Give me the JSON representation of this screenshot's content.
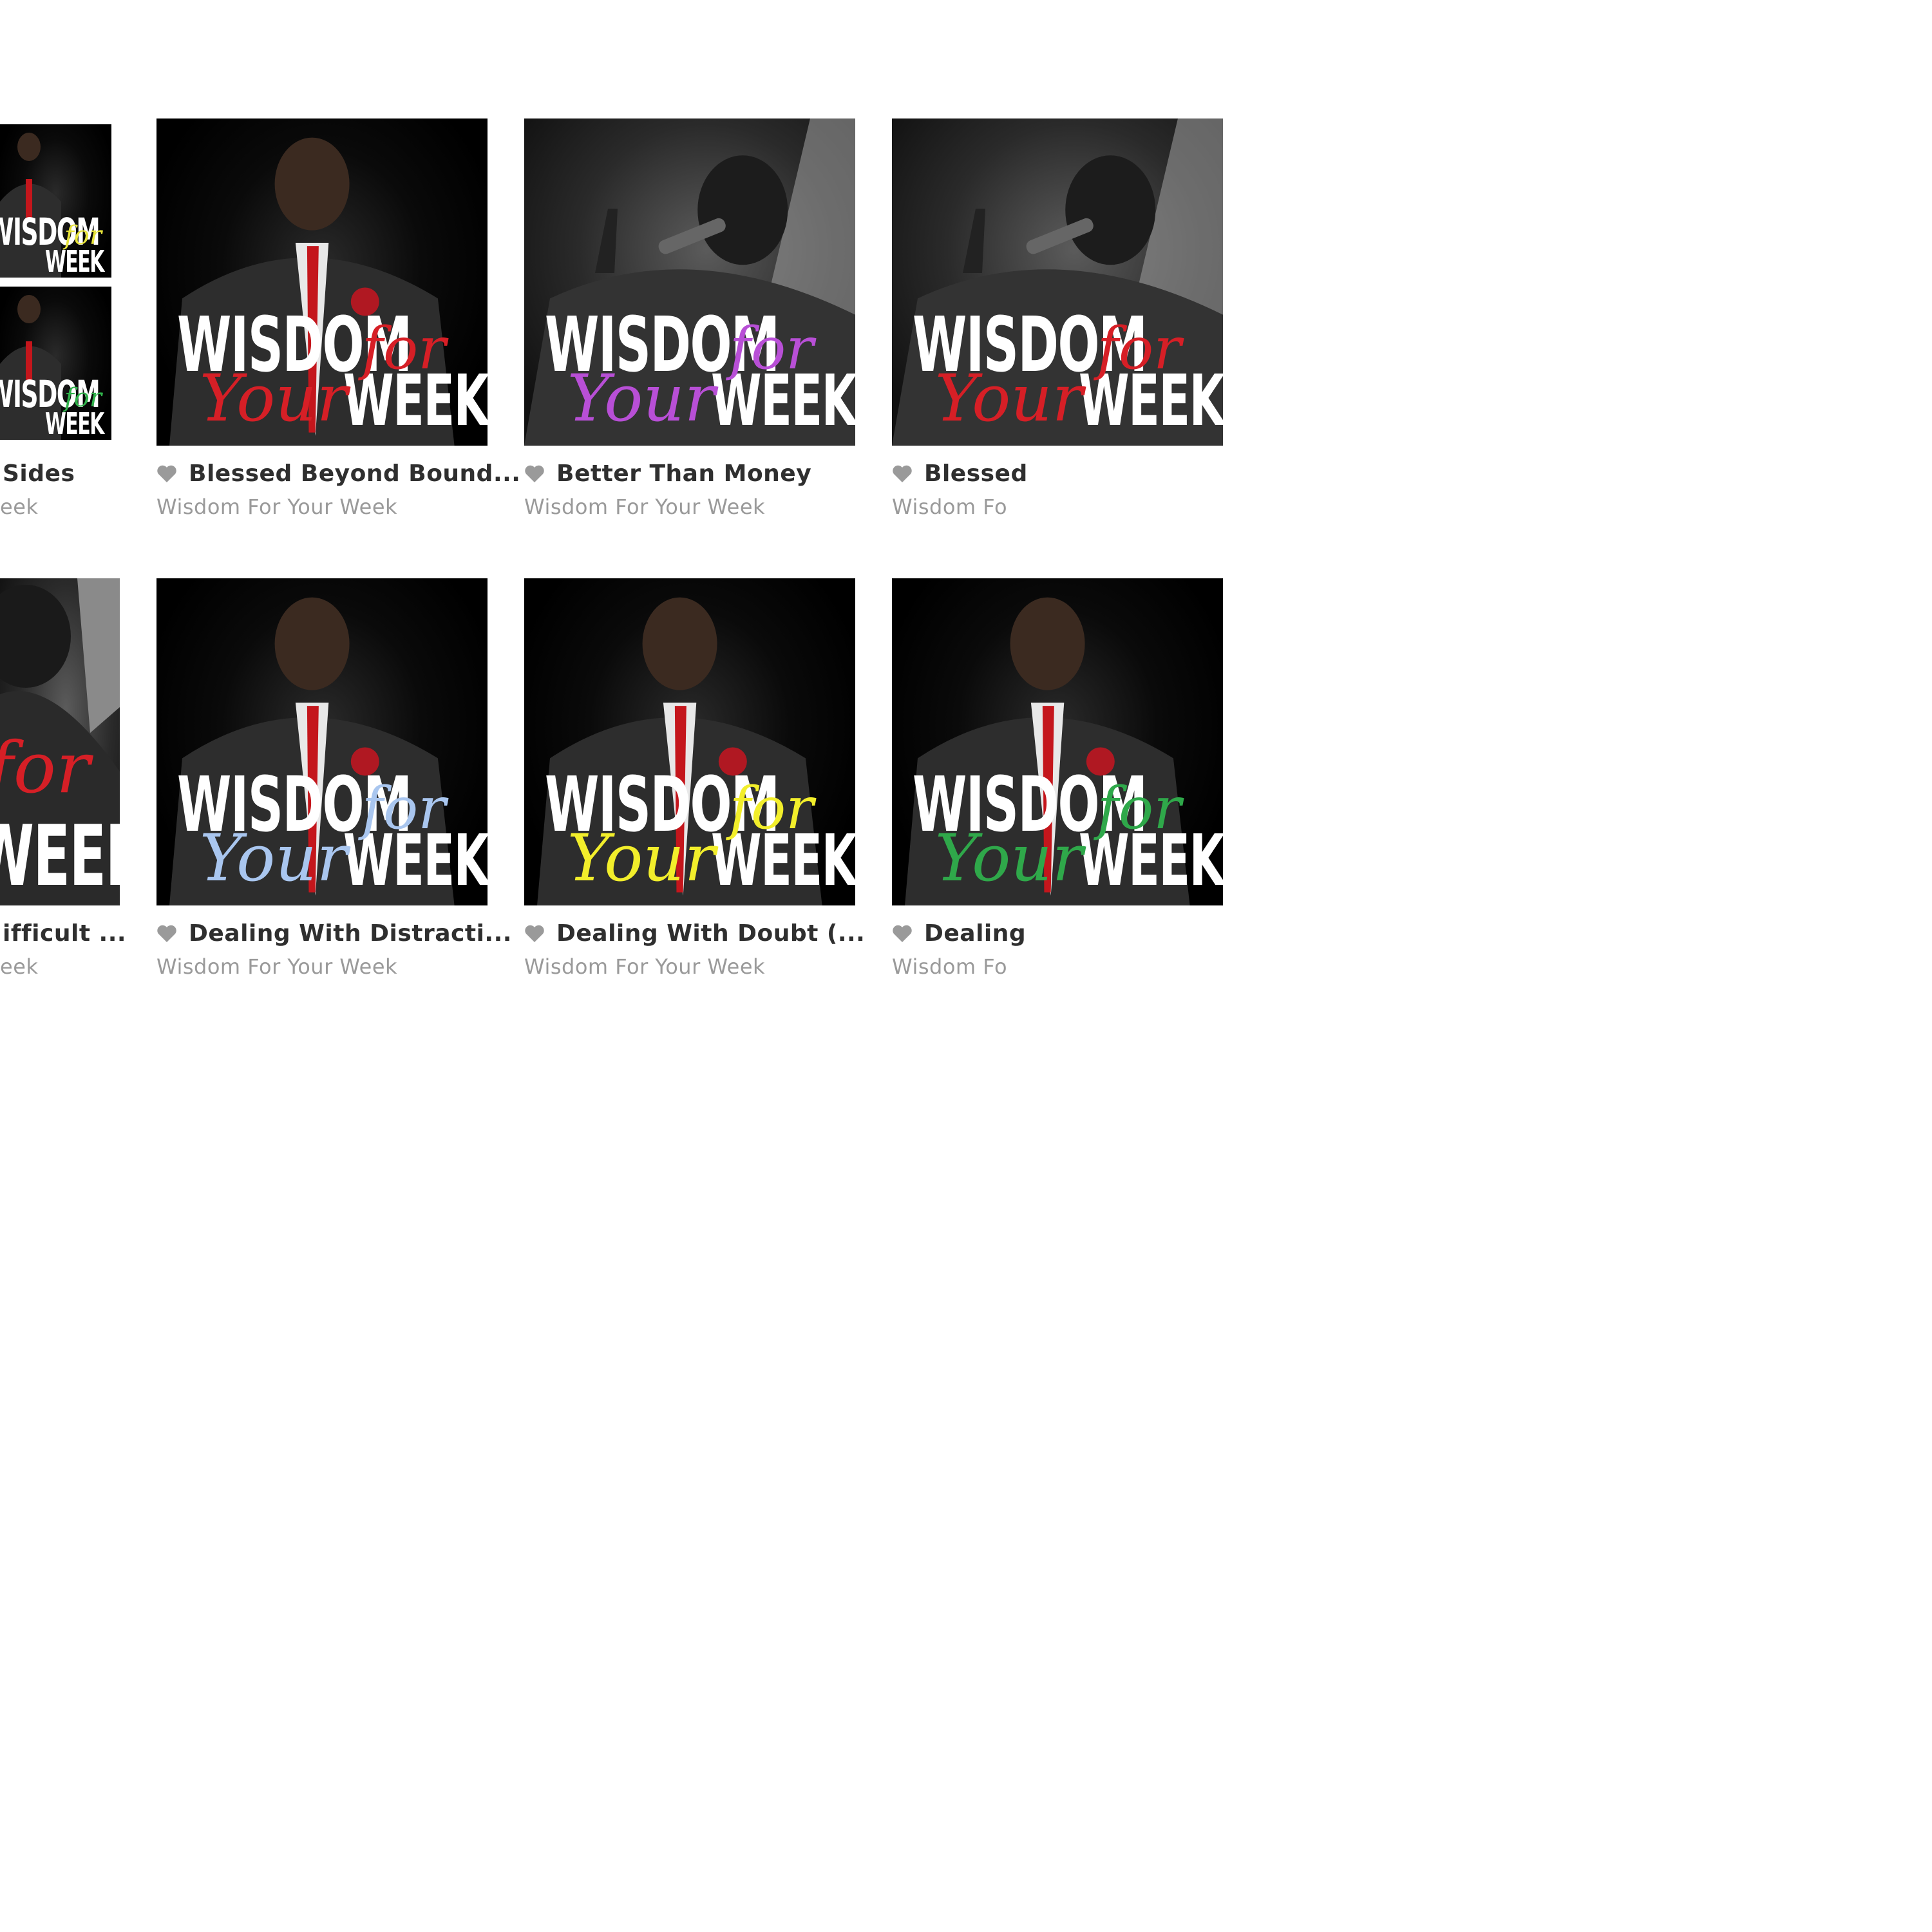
{
  "row1": {
    "left_title_fragment": "Sides",
    "left_sub_fragment": "eek",
    "cards": [
      {
        "title": "Blessed Beyond Bound...",
        "subtitle": "Wisdom For Your Week",
        "script_color": "#d61f26"
      },
      {
        "title": "Better Than Money",
        "subtitle": "Wisdom For Your Week",
        "script_color": "#b84fd6"
      },
      {
        "title": "Blessed",
        "subtitle": "Wisdom Fo",
        "script_color": "#d61f26"
      }
    ],
    "left_thumbs": [
      {
        "script_color": "#e6e23a"
      },
      {
        "script_color": "#2fb14a"
      }
    ]
  },
  "row2": {
    "left_title_fragment": "ifficult ...",
    "left_sub_fragment": "eek",
    "left_script_color": "#d61f26",
    "cards": [
      {
        "title": "Dealing With Distracti...",
        "subtitle": "Wisdom For Your Week",
        "script_color": "#a9c6ef"
      },
      {
        "title": "Dealing With Doubt (...",
        "subtitle": "Wisdom For Your Week",
        "script_color": "#f2ee2b"
      },
      {
        "title": "Dealing",
        "subtitle": "Wisdom Fo",
        "script_color": "#2fa84a"
      }
    ]
  },
  "artwork": {
    "word_wisdom": "WISDOM",
    "word_for": "for",
    "word_your": "Your",
    "word_week": "WEEK"
  },
  "icons": {
    "favorite": "heart-icon"
  }
}
